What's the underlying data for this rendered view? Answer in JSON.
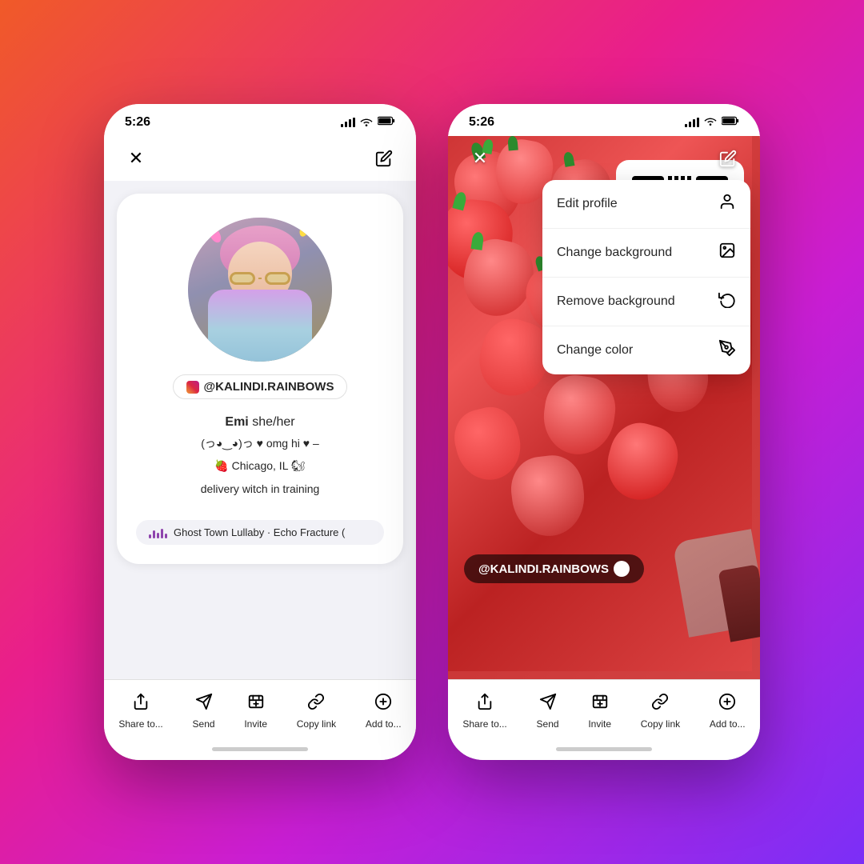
{
  "background": {
    "gradient": "linear-gradient(135deg, #f05a28 0%, #e91e8c 40%, #c91ed4 65%, #7b2ff7 100%)"
  },
  "phone1": {
    "status": {
      "time": "5:26"
    },
    "nav": {
      "close": "✕",
      "edit": "✏"
    },
    "profile": {
      "username": "@KALINDI.RAINBOWS",
      "name": "Emi",
      "pronoun": "she/her",
      "bio_line1": "(っ◕‿◕)っ ♥ omg hi ♥ –",
      "bio_line2": "🍓 Chicago, IL 🐿",
      "bio_line3": "delivery witch in training",
      "music": "Ghost Town Lullaby · Echo Fracture ("
    },
    "actions": [
      {
        "label": "Share to...",
        "icon": "↑"
      },
      {
        "label": "Send",
        "icon": "✈"
      },
      {
        "label": "Invite",
        "icon": "👤"
      },
      {
        "label": "Copy link",
        "icon": "🔗"
      },
      {
        "label": "Add to...",
        "icon": "⊕"
      }
    ]
  },
  "phone2": {
    "status": {
      "time": "5:26"
    },
    "nav": {
      "close": "✕",
      "edit": "✏"
    },
    "dropdown": [
      {
        "label": "Edit profile",
        "icon": "person"
      },
      {
        "label": "Change background",
        "icon": "image"
      },
      {
        "label": "Remove background",
        "icon": "undo"
      },
      {
        "label": "Change color",
        "icon": "pencil"
      }
    ],
    "qr_username": "@KALINDI.RAINBOWS",
    "actions": [
      {
        "label": "Share to...",
        "icon": "↑"
      },
      {
        "label": "Send",
        "icon": "✈"
      },
      {
        "label": "Invite",
        "icon": "👤"
      },
      {
        "label": "Copy link",
        "icon": "🔗"
      },
      {
        "label": "Add to...",
        "icon": "⊕"
      }
    ]
  }
}
